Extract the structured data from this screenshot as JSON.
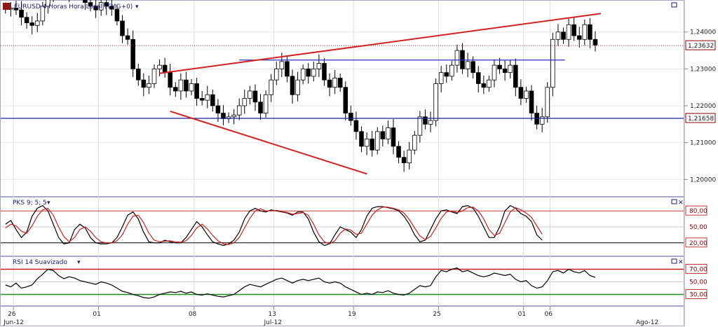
{
  "chart_data": {
    "type": "candlestick",
    "title": "EURUSD 4 Horas Hora Local (TMG+0)",
    "price_axis": {
      "ylim": [
        1.1955,
        1.2485
      ],
      "ticks": [
        "1,24000",
        "1,23000",
        "1,22000",
        "1,21000",
        "1,20000"
      ],
      "tick_values": [
        1.24,
        1.23,
        1.22,
        1.21,
        1.2
      ],
      "current_price_label": "1,23632",
      "current_price": 1.23632,
      "support_label": "1,21658",
      "support": 1.21658,
      "resistance": 1.2324
    },
    "date_axis": {
      "day_labels": [
        {
          "label": "26",
          "bar": 2
        },
        {
          "label": "01",
          "bar": 18
        },
        {
          "label": "08",
          "bar": 36
        },
        {
          "label": "13",
          "bar": 51
        },
        {
          "label": "19",
          "bar": 66
        },
        {
          "label": "25",
          "bar": 82
        },
        {
          "label": "01",
          "bar": 98
        },
        {
          "label": "06",
          "bar": 103
        }
      ],
      "month_labels": [
        {
          "label": "Jun-12",
          "bar": 2
        },
        {
          "label": "Jul-12",
          "bar": 51
        },
        {
          "label": "Ago-12",
          "bar": 121
        }
      ],
      "bar_count": 128,
      "last_bar": 112
    },
    "closes": [
      1.2462,
      1.2465,
      1.246,
      1.244,
      1.2425,
      1.2418,
      1.243,
      1.247,
      1.2495,
      1.251,
      1.254,
      1.252,
      1.2505,
      1.251,
      1.25,
      1.248,
      1.247,
      1.246,
      1.248,
      1.247,
      1.2462,
      1.243,
      1.239,
      1.238,
      1.23,
      1.227,
      1.225,
      1.226,
      1.23,
      1.231,
      1.229,
      1.225,
      1.224,
      1.227,
      1.224,
      1.226,
      1.222,
      1.2215,
      1.223,
      1.22,
      1.218,
      1.2165,
      1.217,
      1.2175,
      1.22,
      1.222,
      1.224,
      1.221,
      1.218,
      1.223,
      1.227,
      1.23,
      1.232,
      1.228,
      1.223,
      1.227,
      1.23,
      1.228,
      1.23,
      1.2315,
      1.227,
      1.225,
      1.2275,
      1.225,
      1.218,
      1.216,
      1.213,
      1.209,
      1.211,
      1.208,
      1.213,
      1.211,
      1.214,
      1.209,
      1.206,
      1.2045,
      1.208,
      1.212,
      1.217,
      1.215,
      1.216,
      1.226,
      1.229,
      1.228,
      1.231,
      1.235,
      1.23,
      1.232,
      1.229,
      1.226,
      1.225,
      1.227,
      1.231,
      1.23,
      1.229,
      1.231,
      1.225,
      1.222,
      1.224,
      1.218,
      1.215,
      1.217,
      1.225,
      1.238,
      1.24,
      1.238,
      1.242,
      1.239,
      1.238,
      1.242,
      1.238,
      1.2365
    ],
    "indicators": [
      {
        "name": "PKS 9; 5; 5",
        "ylim": [
          0,
          100
        ],
        "levels": [
          {
            "label": "80,00",
            "value": 80
          },
          {
            "label": "50,00",
            "value": 50
          },
          {
            "label": "20,00",
            "value": 20
          }
        ],
        "series": [
          {
            "color": "#000000",
            "values": [
              55,
              62,
              45,
              30,
              40,
              70,
              85,
              90,
              80,
              55,
              30,
              18,
              20,
              45,
              55,
              48,
              30,
              20,
              18,
              18,
              20,
              30,
              50,
              72,
              78,
              65,
              40,
              22,
              20,
              20,
              25,
              22,
              20,
              20,
              30,
              45,
              60,
              50,
              35,
              22,
              18,
              15,
              18,
              25,
              40,
              65,
              80,
              85,
              80,
              78,
              82,
              80,
              78,
              76,
              72,
              78,
              78,
              65,
              40,
              22,
              15,
              18,
              35,
              50,
              45,
              40,
              30,
              45,
              70,
              85,
              88,
              88,
              86,
              84,
              80,
              70,
              55,
              35,
              22,
              25,
              45,
              65,
              80,
              82,
              78,
              75,
              88,
              90,
              85,
              70,
              50,
              30,
              30,
              50,
              80,
              90,
              85,
              75,
              70,
              60,
              35,
              25
            ]
          },
          {
            "color": "#cc2222",
            "values": [
              48,
              55,
              52,
              42,
              38,
              52,
              70,
              82,
              85,
              72,
              50,
              32,
              22,
              30,
              45,
              50,
              42,
              30,
              22,
              20,
              20,
              24,
              35,
              55,
              70,
              72,
              58,
              38,
              25,
              22,
              23,
              24,
              22,
              21,
              24,
              34,
              48,
              55,
              46,
              34,
              24,
              18,
              17,
              20,
              30,
              48,
              66,
              80,
              84,
              80,
              80,
              81,
              79,
              77,
              74,
              75,
              77,
              72,
              55,
              35,
              22,
              18,
              24,
              38,
              46,
              44,
              36,
              38,
              55,
              72,
              82,
              87,
              87,
              85,
              82,
              76,
              64,
              48,
              33,
              26,
              32,
              48,
              66,
              78,
              80,
              77,
              80,
              86,
              87,
              80,
              65,
              45,
              34,
              38,
              58,
              78,
              86,
              82,
              76,
              68,
              52,
              36
            ]
          }
        ]
      },
      {
        "name": "RSI 14 Suavizado",
        "ylim": [
          15,
          85
        ],
        "levels": [
          {
            "label": "70,00",
            "value": 70
          },
          {
            "label": "50,00",
            "value": 50
          },
          {
            "label": "30,00",
            "value": 30
          }
        ],
        "series": [
          {
            "color": "#000000",
            "values": [
              45,
              42,
              48,
              40,
              42,
              45,
              55,
              62,
              70,
              68,
              60,
              55,
              58,
              56,
              52,
              50,
              48,
              46,
              50,
              48,
              45,
              40,
              35,
              33,
              30,
              28,
              25,
              24,
              26,
              30,
              32,
              34,
              33,
              35,
              32,
              34,
              30,
              29,
              31,
              29,
              27,
              26,
              28,
              30,
              36,
              42,
              46,
              44,
              42,
              46,
              50,
              54,
              56,
              52,
              48,
              52,
              54,
              52,
              54,
              56,
              50,
              48,
              50,
              48,
              42,
              38,
              34,
              30,
              32,
              30,
              34,
              33,
              36,
              32,
              30,
              29,
              32,
              38,
              44,
              42,
              44,
              58,
              68,
              66,
              70,
              72,
              66,
              68,
              64,
              60,
              58,
              60,
              64,
              62,
              60,
              62,
              54,
              50,
              52,
              44,
              40,
              42,
              52,
              66,
              68,
              64,
              70,
              66,
              64,
              68,
              60,
              57
            ]
          }
        ]
      }
    ]
  }
}
